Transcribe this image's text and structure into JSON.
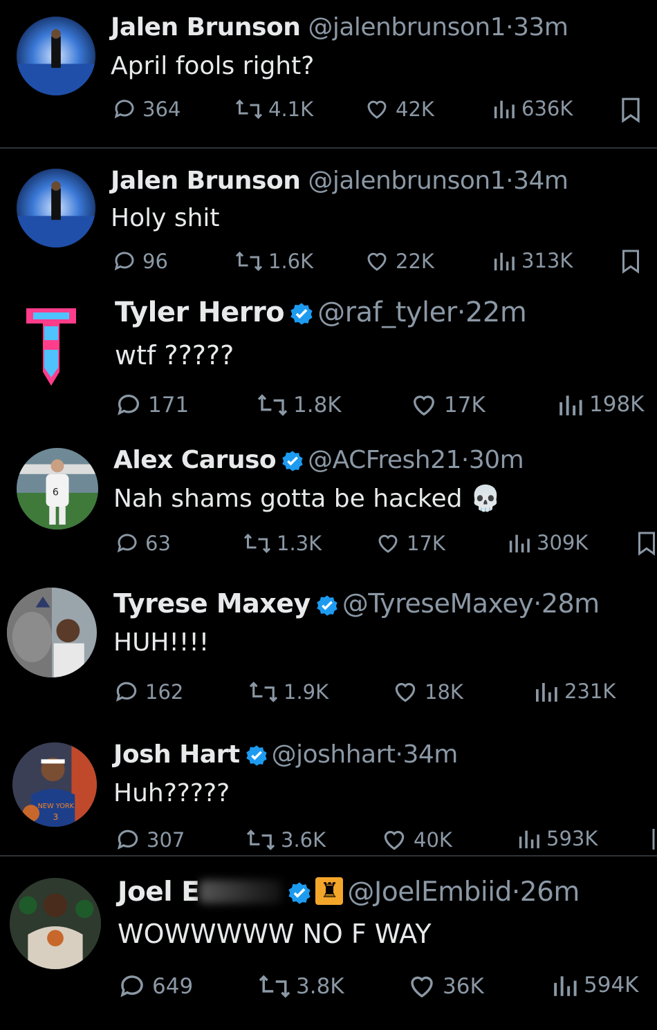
{
  "tweets": [
    {
      "name": "Jalen Brunson",
      "handle": "@jalenbrunson1",
      "time": "33m",
      "text": "April fools right?",
      "replies": "364",
      "retweets": "4.1K",
      "likes": "42K",
      "views": "636K",
      "verified": false
    },
    {
      "name": "Jalen Brunson",
      "handle": "@jalenbrunson1",
      "time": "34m",
      "text": "Holy shit",
      "replies": "96",
      "retweets": "1.6K",
      "likes": "22K",
      "views": "313K",
      "verified": false
    },
    {
      "name": "Tyler Herro",
      "handle": "@raf_tyler",
      "time": "22m",
      "text": "wtf ?????",
      "replies": "171",
      "retweets": "1.8K",
      "likes": "17K",
      "views": "198K",
      "verified": true
    },
    {
      "name": "Alex Caruso",
      "handle": "@ACFresh21",
      "time": "30m",
      "text": "Nah shams gotta be hacked",
      "emoji": "💀",
      "replies": "63",
      "retweets": "1.3K",
      "likes": "17K",
      "views": "309K",
      "verified": true
    },
    {
      "name": "Tyrese Maxey",
      "handle": "@TyreseMaxey",
      "time": "28m",
      "text": "HUH!!!!",
      "replies": "162",
      "retweets": "1.9K",
      "likes": "18K",
      "views": "231K",
      "verified": true
    },
    {
      "name": "Josh Hart",
      "handle": "@joshhart",
      "time": "34m",
      "text": "Huh?????",
      "replies": "307",
      "retweets": "3.6K",
      "likes": "40K",
      "views": "593K",
      "verified": true
    },
    {
      "name": "Joel E",
      "handle": "@JoelEmbiid",
      "time": "26m",
      "text": "WOWWWWW NO F WAY",
      "replies": "649",
      "retweets": "3.8K",
      "likes": "36K",
      "views": "594K",
      "verified": true,
      "badge_icon": "eiffel-tower-icon"
    }
  ],
  "separator": "·",
  "colors": {
    "background": "#000000",
    "text": "#e7e9ea",
    "muted": "#8b98a5",
    "verified": "#1d9bf0"
  }
}
